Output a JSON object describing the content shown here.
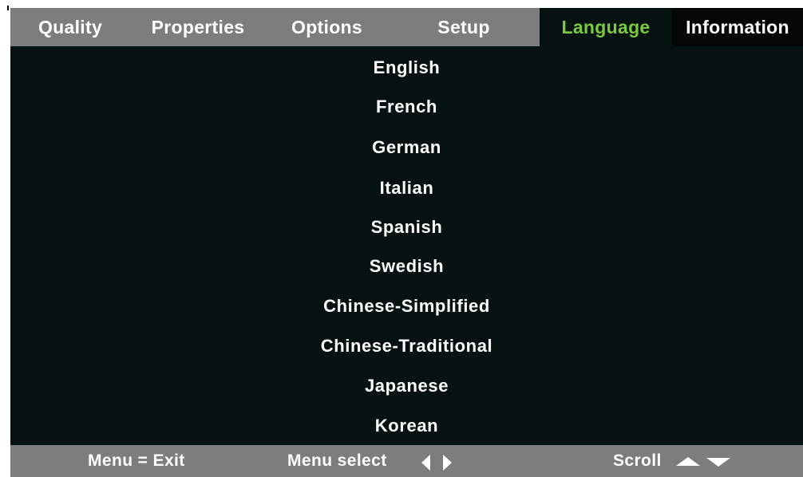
{
  "tabs": [
    {
      "label": "Quality"
    },
    {
      "label": "Properties"
    },
    {
      "label": "Options"
    },
    {
      "label": "Setup"
    },
    {
      "label": "Language",
      "active": true
    },
    {
      "label": "Information"
    }
  ],
  "languages": [
    "English",
    "French",
    "German",
    "Italian",
    "Spanish",
    "Swedish",
    "Chinese-Simplified",
    "Chinese-Traditional",
    "Japanese",
    "Korean"
  ],
  "footer": {
    "exit_hint": "Menu = Exit",
    "select_hint": "Menu select",
    "scroll_hint": "Scroll",
    "icons": {
      "select_left": "arrow-left-icon",
      "select_right": "arrow-right-icon",
      "scroll_up": "arrow-up-icon",
      "scroll_down": "arrow-down-icon"
    }
  },
  "colors": {
    "tab_bar": "#7d7d7d",
    "menu_background": "#051210",
    "active_tab_text": "#7ac943",
    "text": "#ffffff"
  }
}
